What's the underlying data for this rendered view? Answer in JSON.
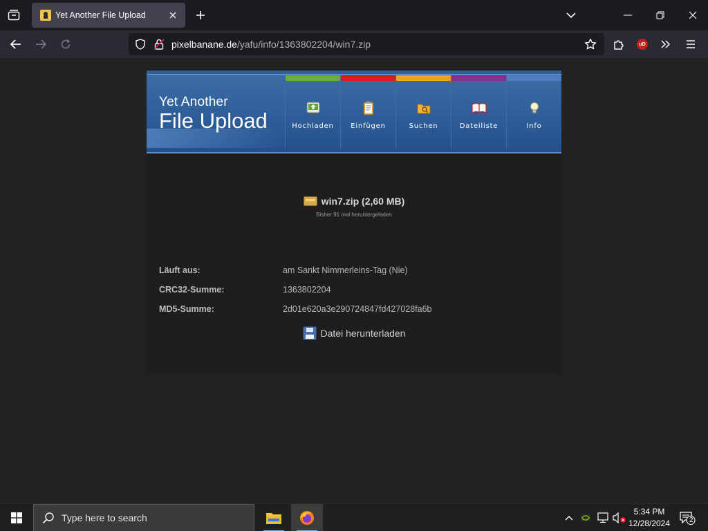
{
  "browser": {
    "tab_title": "Yet Another File Upload",
    "url_host": "pixelbanane.de",
    "url_path": "/yafu/info/1363802204/win7.zip",
    "ublock_badge": "uD"
  },
  "site": {
    "logo_line1": "Yet Another",
    "logo_line2": "File Upload",
    "menu": [
      {
        "label": "Hochladen",
        "color": "#6ab12f",
        "icon": "upload-icon"
      },
      {
        "label": "Einfügen",
        "color": "#e3161a",
        "icon": "clipboard-icon"
      },
      {
        "label": "Suchen",
        "color": "#f4a114",
        "icon": "search-folder-icon"
      },
      {
        "label": "Dateiliste",
        "color": "#8b2c8f",
        "icon": "book-icon"
      },
      {
        "label": "Info",
        "color": "#4e7fc0",
        "icon": "bulb-icon"
      }
    ]
  },
  "file": {
    "title": "win7.zip (2,60 MB)",
    "downloads_note": "Bisher 91 mal heruntergeladen",
    "rows": [
      {
        "key": "Läuft aus:",
        "value": "am Sankt Nimmerleins-Tag (Nie)"
      },
      {
        "key": "CRC32-Summe:",
        "value": "1363802204"
      },
      {
        "key": "MD5-Summe:",
        "value": "2d01e620a3e290724847fd427028fa6b"
      }
    ],
    "download_label": "Datei herunterladen"
  },
  "taskbar": {
    "search_placeholder": "Type here to search",
    "time": "5:34 PM",
    "date": "12/28/2024",
    "notification_count": "2"
  }
}
